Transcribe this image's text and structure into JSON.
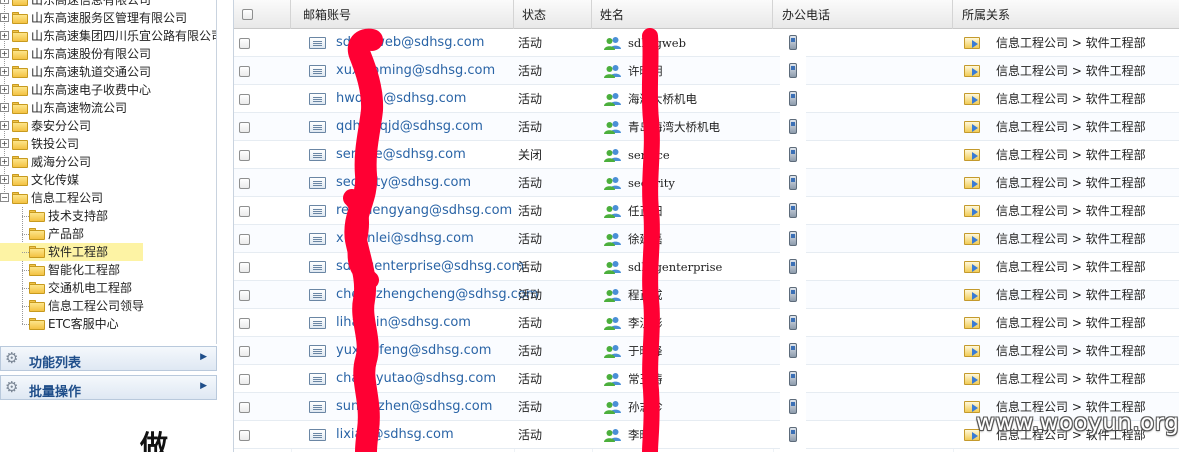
{
  "tree": {
    "items": [
      {
        "label": "山东高速信息有限公司",
        "level": 1,
        "expander": "+"
      },
      {
        "label": "山东高速服务区管理有限公司",
        "level": 1,
        "expander": "+"
      },
      {
        "label": "山东高速集团四川乐宜公路有限公司",
        "level": 1,
        "expander": "+"
      },
      {
        "label": "山东高速股份有限公司",
        "level": 1,
        "expander": "+"
      },
      {
        "label": "山东高速轨道交通公司",
        "level": 1,
        "expander": "+"
      },
      {
        "label": "山东高速电子收费中心",
        "level": 1,
        "expander": "+"
      },
      {
        "label": "山东高速物流公司",
        "level": 1,
        "expander": "+"
      },
      {
        "label": "泰安分公司",
        "level": 1,
        "expander": "+"
      },
      {
        "label": "铁投公司",
        "level": 1,
        "expander": "+"
      },
      {
        "label": "威海分公司",
        "level": 1,
        "expander": "+"
      },
      {
        "label": "文化传媒",
        "level": 1,
        "expander": "+"
      },
      {
        "label": "信息工程公司",
        "level": 1,
        "expander": "−"
      },
      {
        "label": "技术支持部",
        "level": 2
      },
      {
        "label": "产品部",
        "level": 2
      },
      {
        "label": "软件工程部",
        "level": 2,
        "selected": true
      },
      {
        "label": "智能化工程部",
        "level": 2
      },
      {
        "label": "交通机电工程部",
        "level": 2
      },
      {
        "label": "信息工程公司领导",
        "level": 2
      },
      {
        "label": "ETC客服中心",
        "level": 2
      }
    ]
  },
  "accordions": [
    {
      "label": "功能列表",
      "icon": "gear-icon"
    },
    {
      "label": "批量操作",
      "icon": "gear-icon"
    }
  ],
  "partial_glyph": "做",
  "grid": {
    "headers": {
      "email": "邮箱账号",
      "status": "状态",
      "name": "姓名",
      "phone": "办公电话",
      "dept": "所属关系"
    },
    "rows": [
      {
        "email": "sdhsgweb@sdhsg.com",
        "status": "活动",
        "name": "sdhsgweb",
        "dept": "信息工程公司 > 软件工程部"
      },
      {
        "email": "xuxiaoming@sdhsg.com",
        "status": "活动",
        "name": "许晓明",
        "dept": "信息工程公司 > 软件工程部"
      },
      {
        "email": "hwdqjd@sdhsg.com",
        "status": "活动",
        "name": "海湾大桥机电",
        "dept": "信息工程公司 > 软件工程部"
      },
      {
        "email": "qdhwdqjd@sdhsg.com",
        "status": "活动",
        "name": "青岛海湾大桥机电",
        "dept": "信息工程公司 > 软件工程部"
      },
      {
        "email": "service@sdhsg.com",
        "status": "关闭",
        "name": "service",
        "dept": "信息工程公司 > 软件工程部"
      },
      {
        "email": "security@sdhsg.com",
        "status": "活动",
        "name": "security",
        "dept": "信息工程公司 > 软件工程部"
      },
      {
        "email": "renzhengyang@sdhsg.com",
        "status": "活动",
        "name": "任正阳",
        "dept": "信息工程公司 > 软件工程部"
      },
      {
        "email": "xujianlei@sdhsg.com",
        "status": "活动",
        "name": "徐建磊",
        "dept": "信息工程公司 > 软件工程部"
      },
      {
        "email": "sdhsgenterprise@sdhsg.com",
        "status": "活动",
        "name": "sdhsgenterprise",
        "dept": "信息工程公司 > 软件工程部"
      },
      {
        "email": "chengzhengcheng@sdhsg.com",
        "status": "活动",
        "name": "程正成",
        "dept": "信息工程公司 > 软件工程部"
      },
      {
        "email": "lihanbin@sdhsg.com",
        "status": "活动",
        "name": "李汉彬",
        "dept": "信息工程公司 > 软件工程部"
      },
      {
        "email": "yuxiaofeng@sdhsg.com",
        "status": "活动",
        "name": "于晓峰",
        "dept": "信息工程公司 > 软件工程部"
      },
      {
        "email": "changyutao@sdhsg.com",
        "status": "活动",
        "name": "常玉涛",
        "dept": "信息工程公司 > 软件工程部"
      },
      {
        "email": "sunzhizhen@sdhsg.com",
        "status": "活动",
        "name": "孙志珍",
        "dept": "信息工程公司 > 软件工程部"
      },
      {
        "email": "lixiao@sdhsg.com",
        "status": "活动",
        "name": "李晓",
        "dept": "信息工程公司 > 软件工程部"
      }
    ]
  },
  "watermark": "www.wooyun.org",
  "colors": {
    "email_link": "#2a64a6",
    "accordion_text": "#1f4e8a",
    "selected_bg": "#fdf3a4",
    "redaction": "#ff0033"
  }
}
